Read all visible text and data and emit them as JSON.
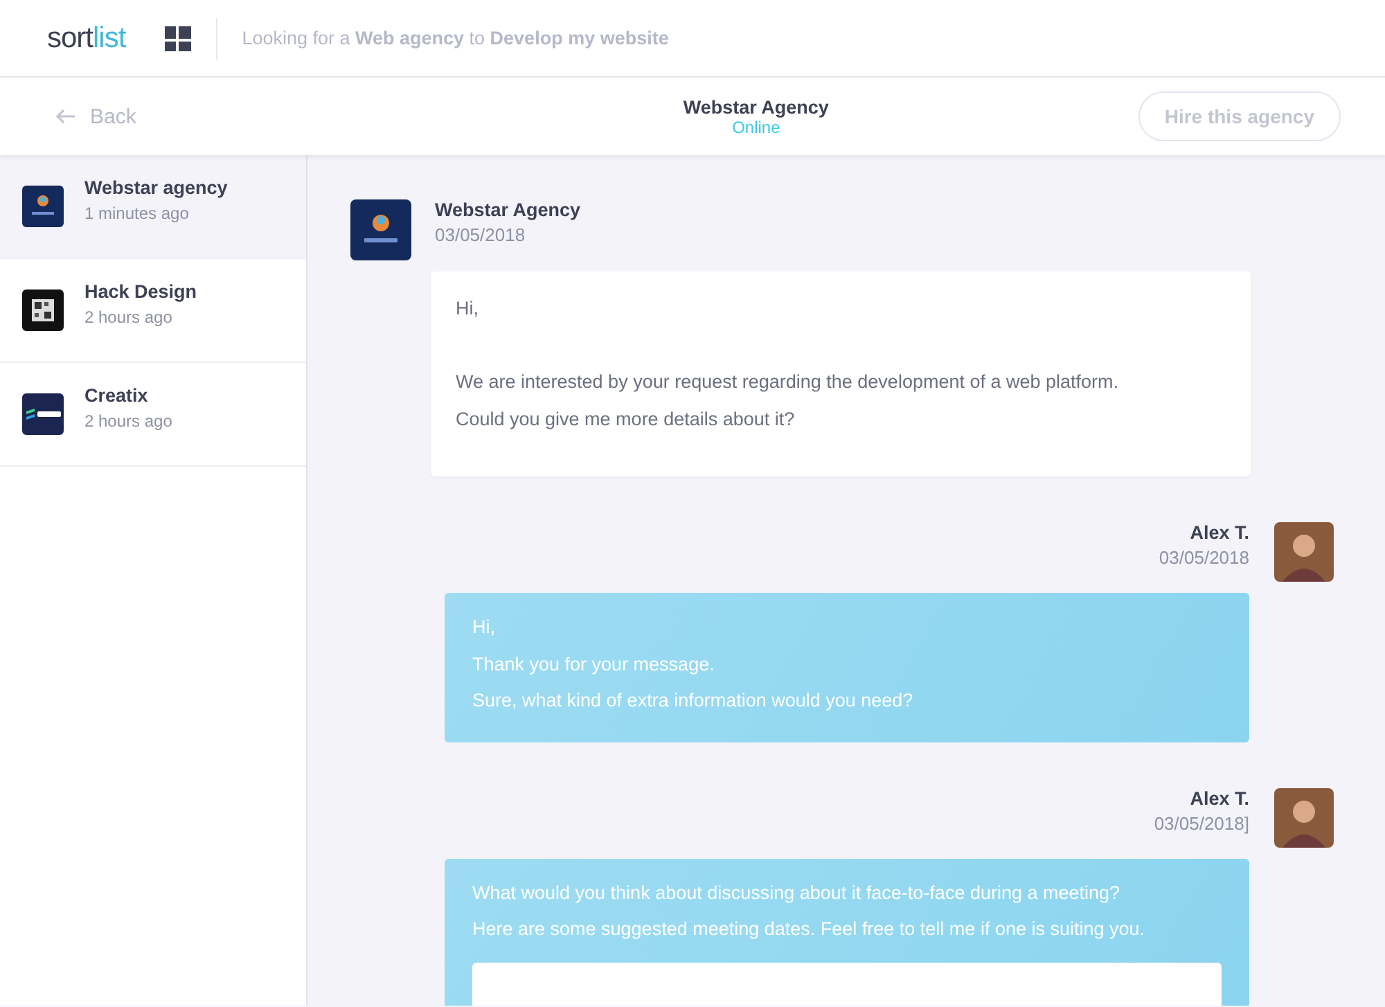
{
  "header": {
    "logo": {
      "part_1": "sort",
      "part_2": "list"
    },
    "tagline": "Looking for a **Web agency** to **Develop my website**"
  },
  "subheader": {
    "back": "Back",
    "title": "Webstar Agency",
    "status": "Online",
    "button": {
      "label": "Hire this agency",
      "disabled": true
    }
  },
  "conversations": [
    {
      "name": "Webstar agency",
      "time": "1 minutes ago",
      "selected": true,
      "kind": "parakeet"
    },
    {
      "name": "Hack Design",
      "time": "2 hours ago",
      "selected": false,
      "kind": "qr"
    },
    {
      "name": "Creatix",
      "time": "2 hours ago",
      "selected": false,
      "kind": "scope"
    }
  ],
  "messages": [
    {
      "kind": "received",
      "sender": "Webstar Agency",
      "date": "03/05/2018",
      "paragraphs": [
        [
          "Hi,"
        ],
        [
          "We are interested by your request regarding the development of a web platform.",
          "Could you give me more details about it?"
        ]
      ]
    },
    {
      "kind": "sent",
      "sender": "Alex T.",
      "date": "03/05/2018",
      "paragraphs": [
        [
          "Hi,",
          "Thank you for your message.",
          "Sure, what kind of extra information would you need?"
        ]
      ]
    },
    {
      "kind": "sent",
      "sender": "Alex T.",
      "date": "03/05/2018]",
      "paragraphs": [
        [
          "What would you think about discussing about it face-to-face during a meeting?",
          "Here are some suggested meeting dates. Feel free to tell me if one is suiting you."
        ]
      ],
      "attachment": true
    }
  ]
}
